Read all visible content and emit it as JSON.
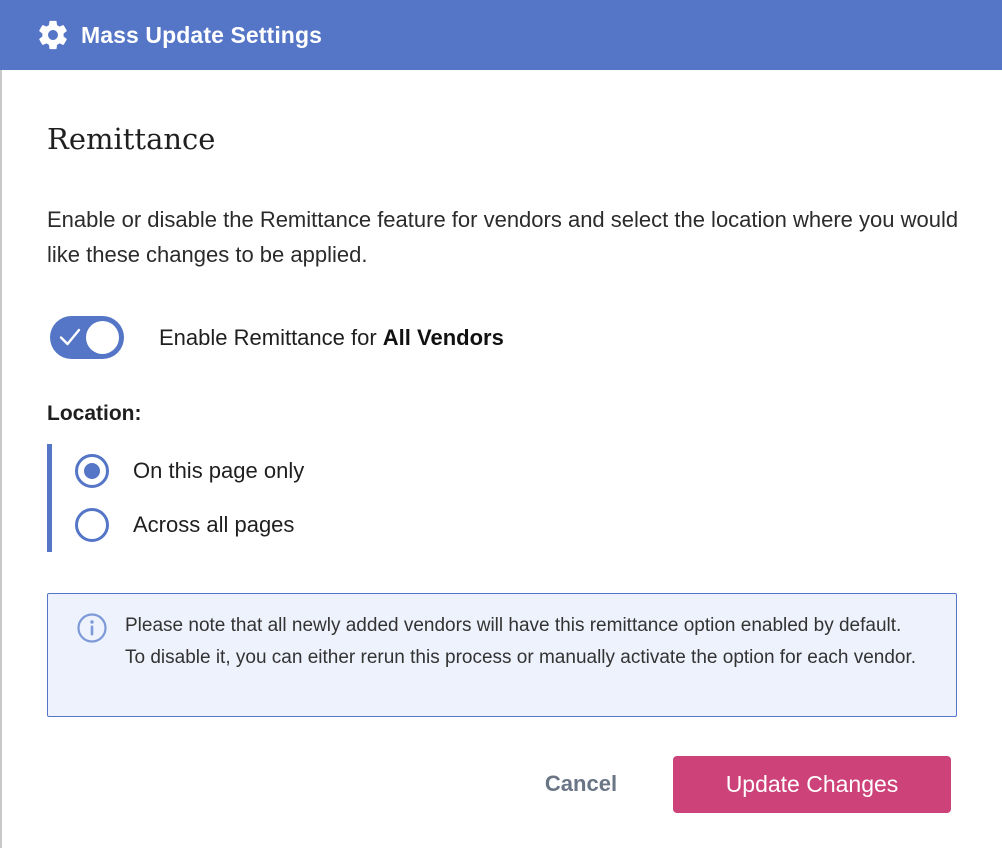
{
  "header": {
    "title": "Mass Update Settings",
    "icon": "gear-icon",
    "background": "#5576c7"
  },
  "section": {
    "title": "Remittance",
    "description": "Enable or disable the Remittance feature for vendors and select the location where you would like these changes to be applied."
  },
  "toggle": {
    "label_prefix": "Enable Remittance for ",
    "label_bold": "All Vendors",
    "enabled": true
  },
  "location": {
    "label": "Location:",
    "options": [
      {
        "label": "On this page only",
        "checked": true
      },
      {
        "label": "Across all pages",
        "checked": false
      }
    ]
  },
  "info": {
    "icon": "info-icon",
    "text": "Please note that all newly added vendors will have this remittance option enabled by default. To disable it, you can either rerun this process or manually activate the option for each vendor."
  },
  "actions": {
    "cancel_label": "Cancel",
    "update_label": "Update Changes",
    "update_color": "#cc4279"
  }
}
